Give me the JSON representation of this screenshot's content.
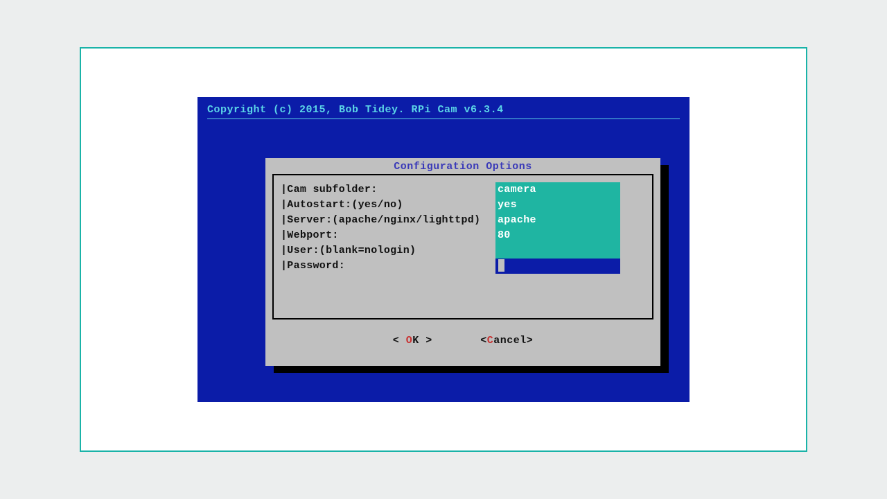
{
  "header": {
    "copyright": "Copyright (c) 2015, Bob Tidey. RPi Cam v6.3.4"
  },
  "dialog": {
    "title": "Configuration Options",
    "fields": {
      "subfolder_label": "|Cam subfolder:",
      "subfolder_value": "camera",
      "autostart_label": "|Autostart:(yes/no)",
      "autostart_value": "yes",
      "server_label": "|Server:(apache/nginx/lighttpd)",
      "server_value": "apache",
      "webport_label": "|Webport:",
      "webport_value": "80",
      "user_label": "|User:(blank=nologin)",
      "user_value": "",
      "password_label": "|Password:",
      "password_value": ""
    },
    "buttons": {
      "ok_open": "<  ",
      "ok_hot": "O",
      "ok_rest": "K  >",
      "cancel_open": "<",
      "cancel_hot": "C",
      "cancel_rest": "ancel>"
    }
  }
}
